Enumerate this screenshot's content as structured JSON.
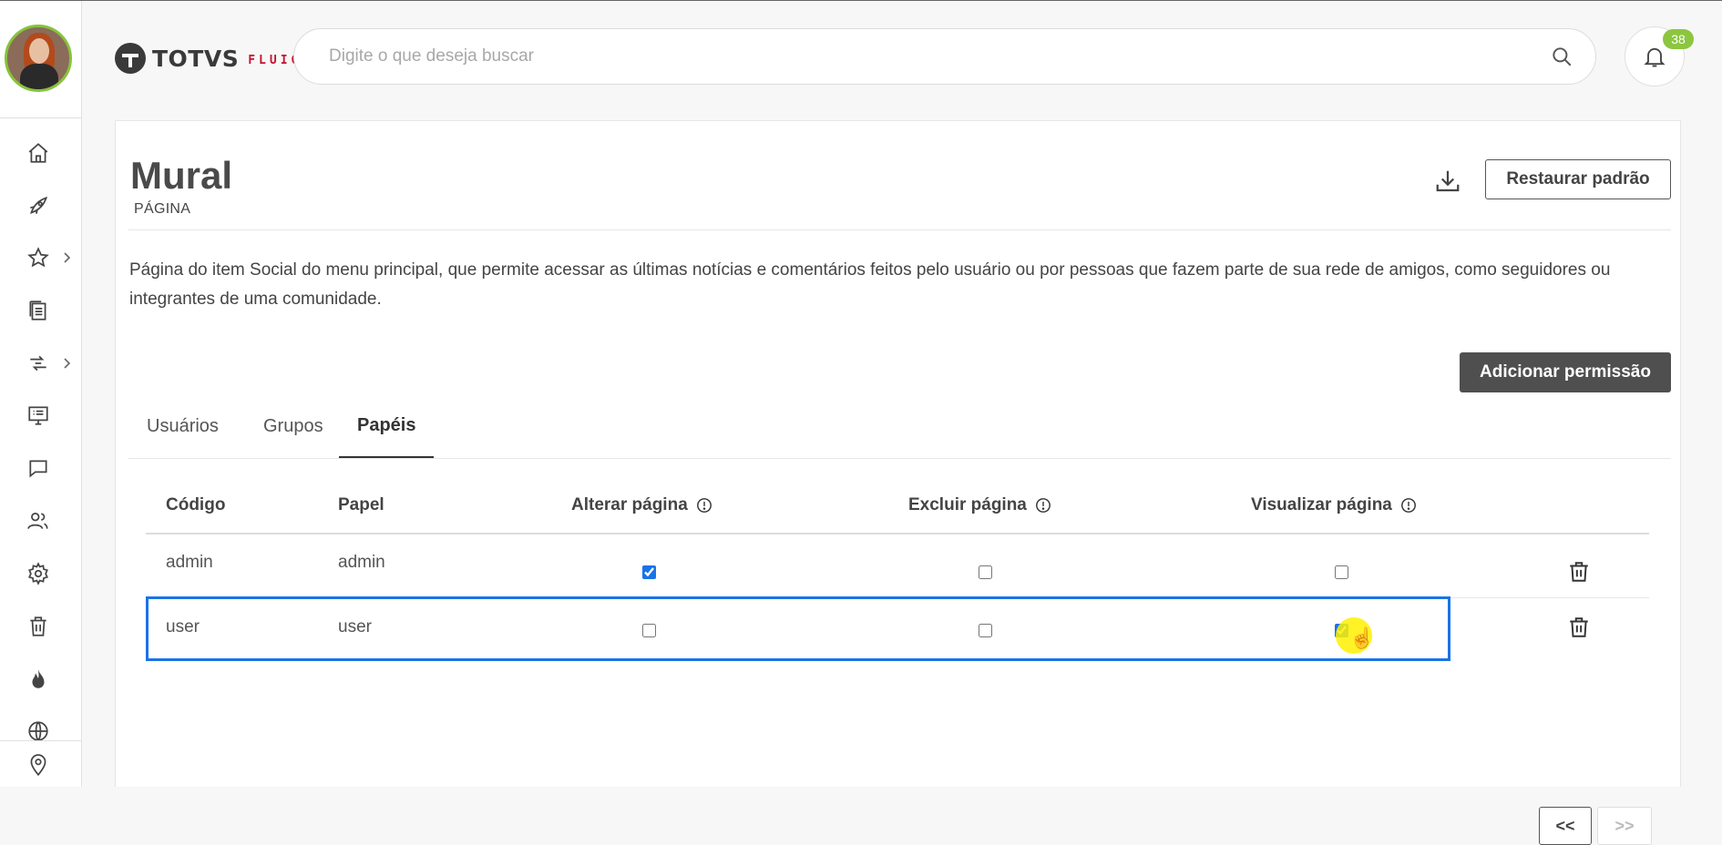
{
  "header": {
    "logo_text": "TOTVS",
    "logo_sub": "FLUIG",
    "search_placeholder": "Digite o que deseja buscar",
    "notification_count": "38"
  },
  "sidebar": {
    "items": [
      {
        "icon": "home-icon"
      },
      {
        "icon": "rocket-icon"
      },
      {
        "icon": "star-icon",
        "has_submenu": true
      },
      {
        "icon": "documents-icon"
      },
      {
        "icon": "workflow-icon",
        "has_submenu": true
      },
      {
        "icon": "monitor-icon"
      },
      {
        "icon": "chat-icon"
      },
      {
        "icon": "users-icon"
      },
      {
        "icon": "gear-icon"
      },
      {
        "icon": "trash-icon"
      },
      {
        "icon": "flame-icon"
      },
      {
        "icon": "globe-icon"
      },
      {
        "icon": "location-icon"
      }
    ]
  },
  "page": {
    "title": "Mural",
    "subtitle": "PÁGINA",
    "restore_label": "Restaurar padrão",
    "description": "Página do item Social do menu principal, que permite acessar as últimas notícias e comentários feitos pelo usuário ou por pessoas que fazem parte de sua rede de amigos, como seguidores ou integrantes de uma comunidade.",
    "add_permission_label": "Adicionar permissão"
  },
  "tabs": [
    {
      "label": "Usuários",
      "active": false
    },
    {
      "label": "Grupos",
      "active": false
    },
    {
      "label": "Papéis",
      "active": true
    }
  ],
  "table": {
    "columns": [
      "Código",
      "Papel",
      "Alterar página",
      "Excluir página",
      "Visualizar página"
    ],
    "rows": [
      {
        "codigo": "admin",
        "papel": "admin",
        "alterar": true,
        "excluir": false,
        "visualizar": false
      },
      {
        "codigo": "user",
        "papel": "user",
        "alterar": false,
        "excluir": false,
        "visualizar": true
      }
    ]
  },
  "pagination": {
    "prev_label": "<<",
    "next_label": ">>"
  },
  "colors": {
    "accent": "#1a73e8",
    "badge": "#8cc63f",
    "brand_red": "#c8102e",
    "dark_button": "#4f4f4f"
  }
}
